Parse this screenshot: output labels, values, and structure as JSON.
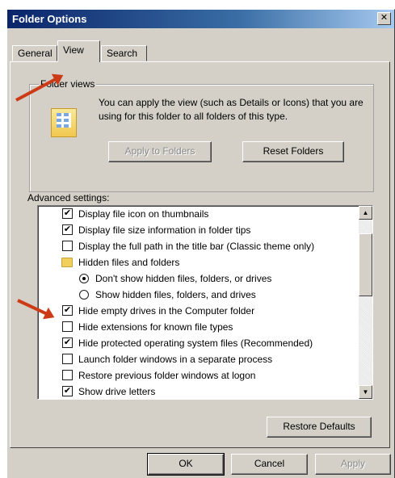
{
  "window": {
    "title": "Folder Options",
    "close_glyph": "✕"
  },
  "tabs": [
    {
      "label": "General",
      "active": false
    },
    {
      "label": "View",
      "active": true
    },
    {
      "label": "Search",
      "active": false
    }
  ],
  "folder_views": {
    "legend": "Folder views",
    "icon": "folder-views-icon",
    "description": "You can apply the view (such as Details or Icons) that you are using for this folder to all folders of this type.",
    "apply_label": "Apply to Folders",
    "reset_label": "Reset Folders"
  },
  "advanced": {
    "label": "Advanced settings:",
    "items": [
      {
        "type": "checkbox",
        "checked": true,
        "label": "Display file icon on thumbnails"
      },
      {
        "type": "checkbox",
        "checked": true,
        "label": "Display file size information in folder tips"
      },
      {
        "type": "checkbox",
        "checked": false,
        "label": "Display the full path in the title bar (Classic theme only)"
      },
      {
        "type": "folder",
        "label": "Hidden files and folders"
      },
      {
        "type": "radio",
        "selected": true,
        "label": "Don't show hidden files, folders, or drives"
      },
      {
        "type": "radio",
        "selected": false,
        "label": "Show hidden files, folders, and drives"
      },
      {
        "type": "checkbox",
        "checked": true,
        "label": "Hide empty drives in the Computer folder"
      },
      {
        "type": "checkbox",
        "checked": false,
        "label": "Hide extensions for known file types"
      },
      {
        "type": "checkbox",
        "checked": true,
        "label": "Hide protected operating system files (Recommended)"
      },
      {
        "type": "checkbox",
        "checked": false,
        "label": "Launch folder windows in a separate process"
      },
      {
        "type": "checkbox",
        "checked": false,
        "label": "Restore previous folder windows at logon"
      },
      {
        "type": "checkbox",
        "checked": true,
        "label": "Show drive letters"
      }
    ],
    "check_glyph": "✔",
    "restore_defaults_label": "Restore Defaults"
  },
  "footer": {
    "ok_label": "OK",
    "cancel_label": "Cancel",
    "apply_label": "Apply"
  },
  "colors": {
    "annotation_arrow": "#cc3a16",
    "title_bar": "#0a246a"
  }
}
